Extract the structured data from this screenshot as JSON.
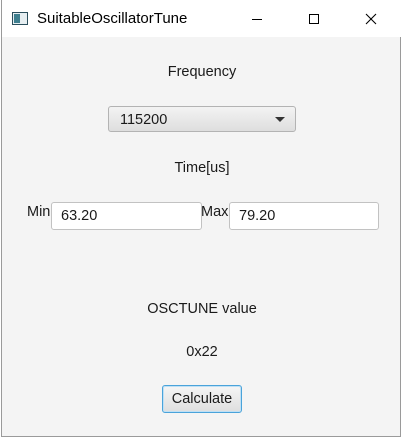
{
  "window": {
    "title": "SuitableOscillatorTune",
    "icons": {
      "app": "app-window-icon",
      "minimize": "minimize-icon",
      "maximize": "maximize-icon",
      "close": "close-icon"
    }
  },
  "frequency": {
    "label": "Frequency",
    "selected": "115200"
  },
  "time": {
    "label": "Time[us]",
    "min_label": "Min",
    "min_value": "63.20",
    "max_label": "Max",
    "max_value": "79.20"
  },
  "result": {
    "label": "OSCTUNE value",
    "value": "0x22"
  },
  "actions": {
    "calculate_label": "Calculate"
  },
  "colors": {
    "focus_border": "#4aa3da",
    "background": "#f4f4f4"
  }
}
